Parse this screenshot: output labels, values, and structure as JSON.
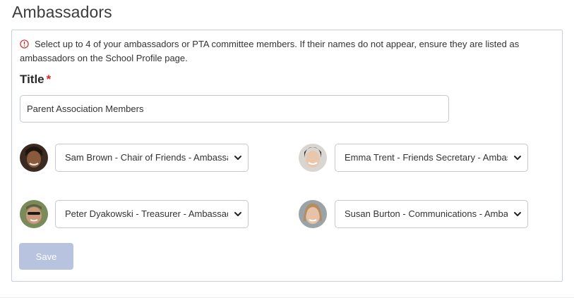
{
  "page": {
    "title": "Ambassadors"
  },
  "info": {
    "icon": "info-circle-icon",
    "color": "#d62b2b",
    "text": "Select up to 4 of your ambassadors or PTA committee members. If their names do not appear, ensure they are listed as ambassadors on the School Profile page."
  },
  "title_field": {
    "label": "Title",
    "required_mark": "*",
    "value": "Parent Association Members"
  },
  "members": [
    {
      "avatar": "avatar-photo",
      "selected": "Sam Brown - Chair of Friends - Ambassador"
    },
    {
      "avatar": "avatar-photo",
      "selected": "Emma Trent - Friends Secretary - Ambassador"
    },
    {
      "avatar": "avatar-photo",
      "selected": "Peter Dyakowski - Treasurer - Ambassador"
    },
    {
      "avatar": "avatar-photo",
      "selected": "Susan Burton - Communications - Ambassador"
    }
  ],
  "save_button": {
    "label": "Save",
    "enabled": false,
    "color": "#b8c3e0"
  }
}
